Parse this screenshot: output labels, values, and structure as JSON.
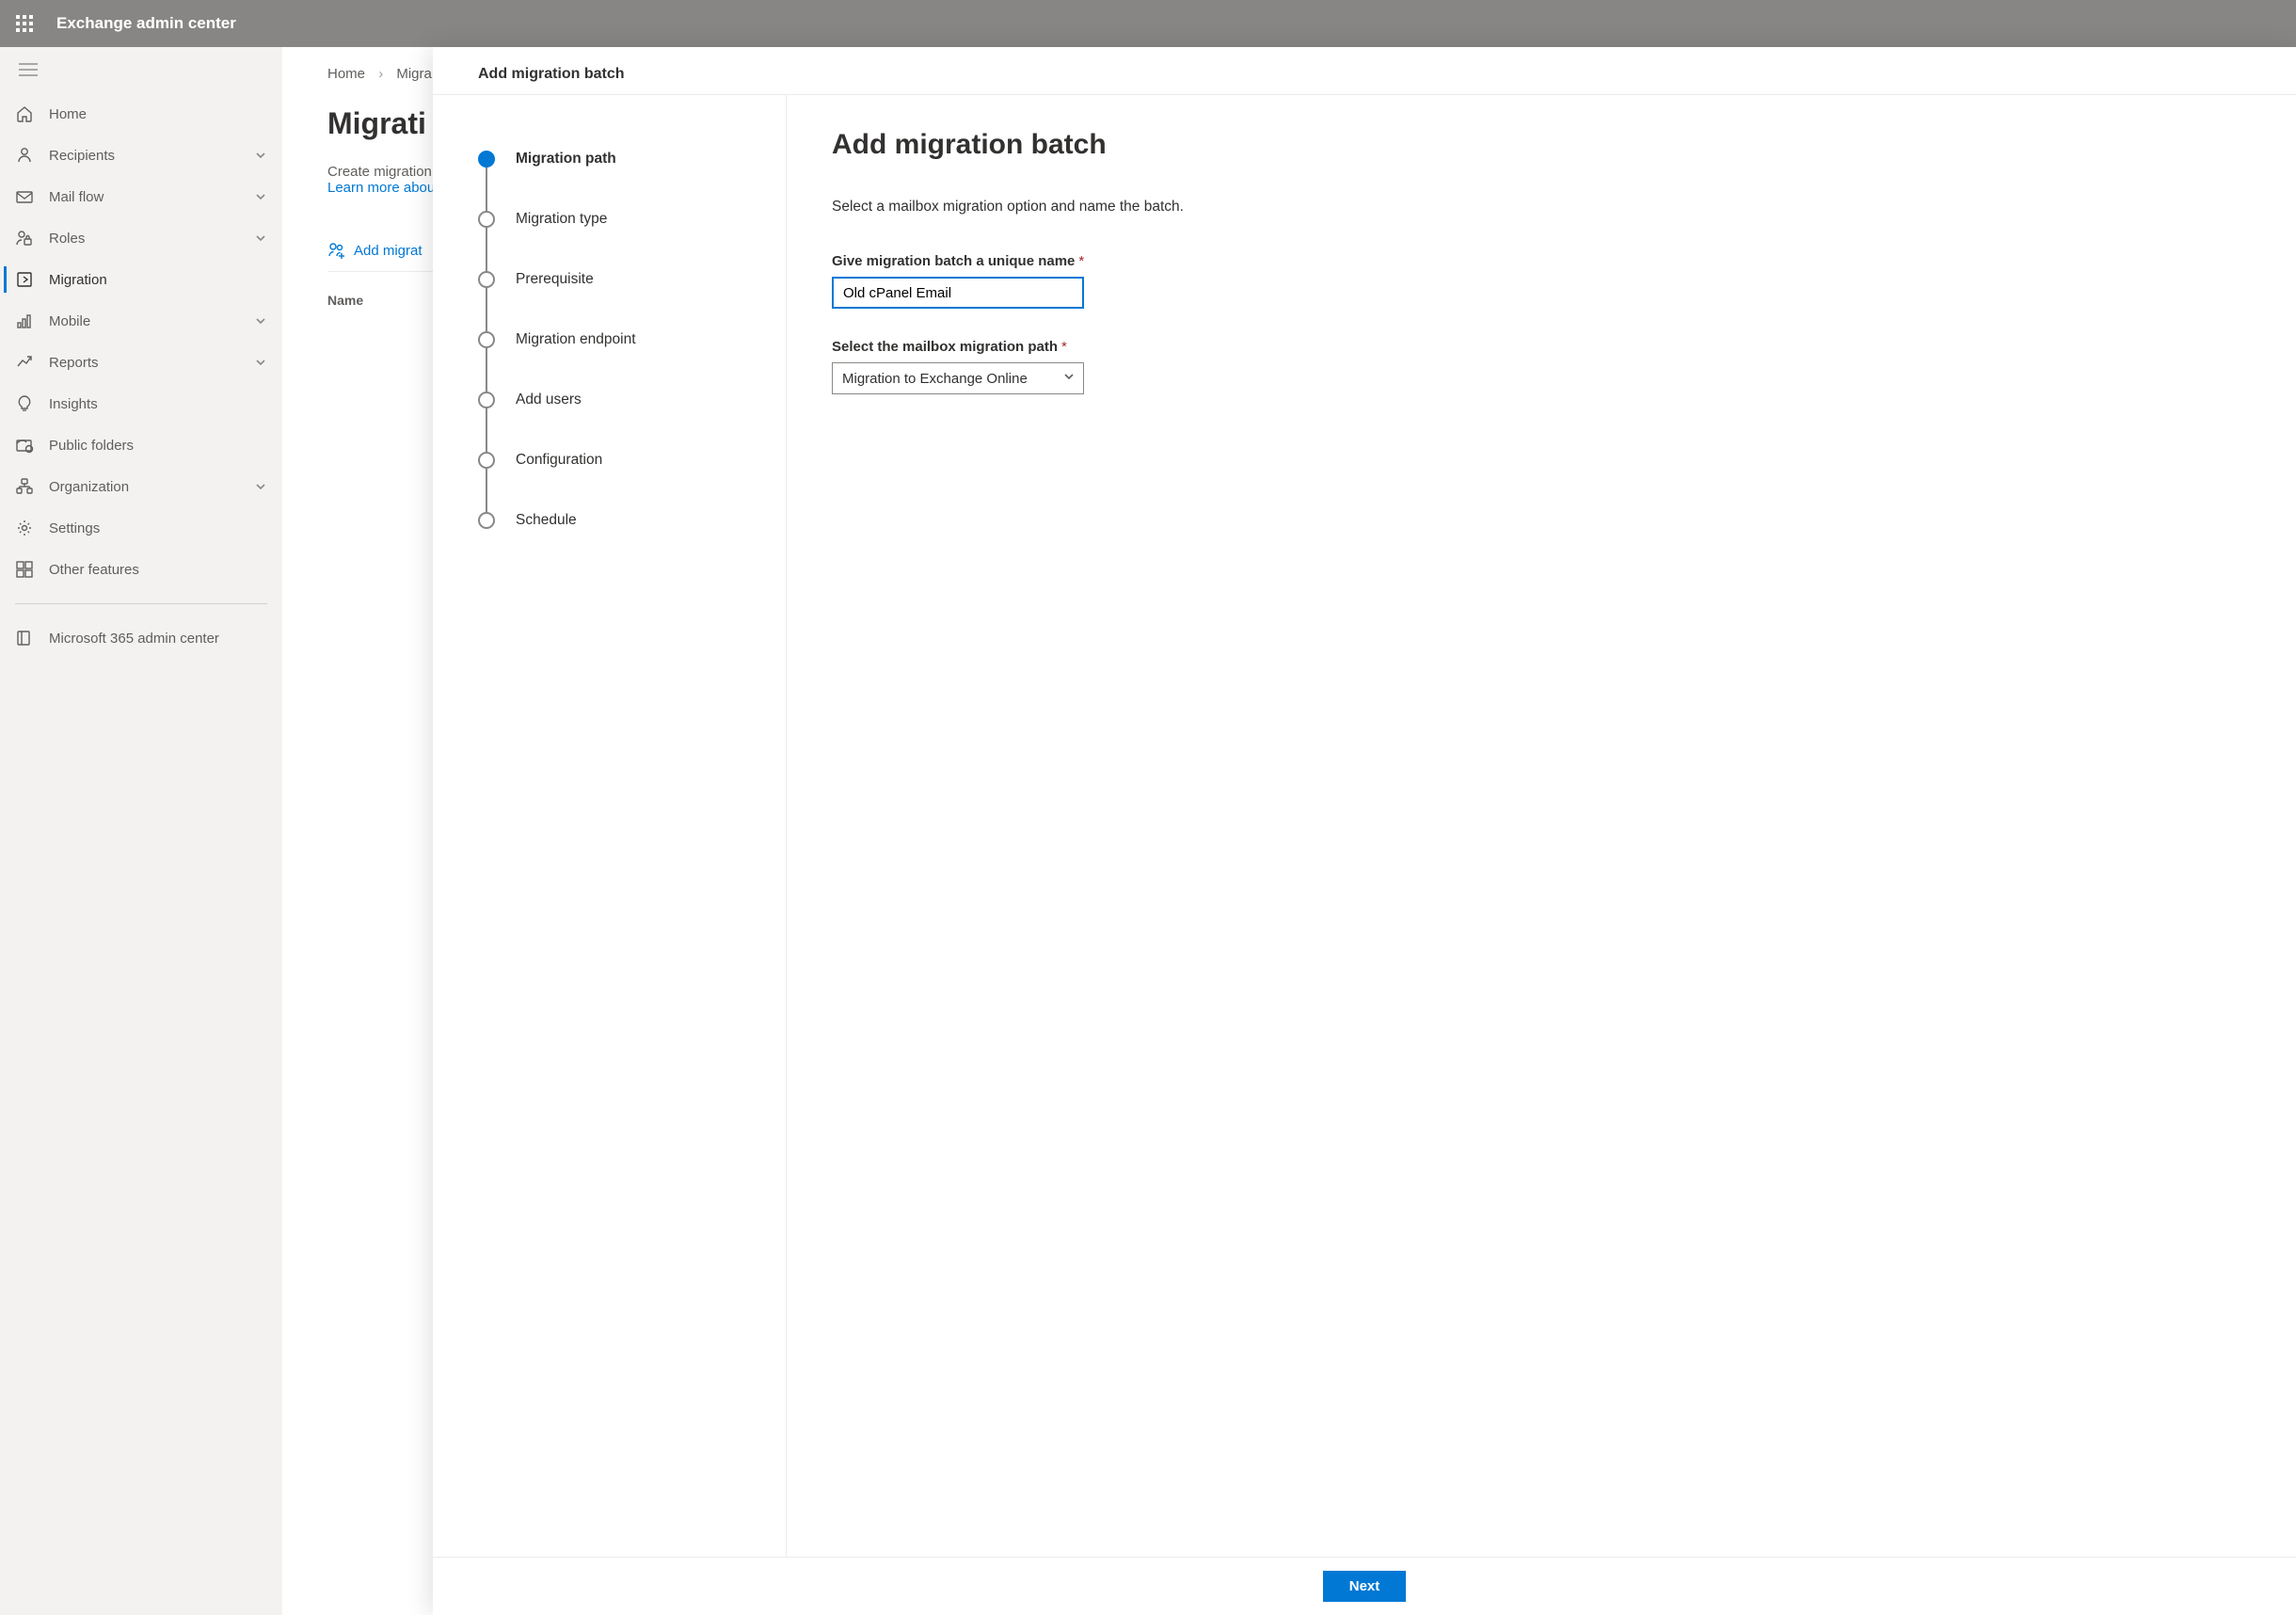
{
  "header": {
    "app_title": "Exchange admin center"
  },
  "sidebar": {
    "items": [
      {
        "label": "Home",
        "icon": "home-icon",
        "expandable": false
      },
      {
        "label": "Recipients",
        "icon": "person-icon",
        "expandable": true
      },
      {
        "label": "Mail flow",
        "icon": "mail-icon",
        "expandable": true
      },
      {
        "label": "Roles",
        "icon": "roles-icon",
        "expandable": true
      },
      {
        "label": "Migration",
        "icon": "migration-icon",
        "expandable": false,
        "active": true
      },
      {
        "label": "Mobile",
        "icon": "mobile-icon",
        "expandable": true
      },
      {
        "label": "Reports",
        "icon": "reports-icon",
        "expandable": true
      },
      {
        "label": "Insights",
        "icon": "insights-icon",
        "expandable": false
      },
      {
        "label": "Public folders",
        "icon": "public-folders-icon",
        "expandable": false
      },
      {
        "label": "Organization",
        "icon": "organization-icon",
        "expandable": true
      },
      {
        "label": "Settings",
        "icon": "settings-icon",
        "expandable": false
      },
      {
        "label": "Other features",
        "icon": "grid-icon",
        "expandable": false
      }
    ],
    "footer_link": "Microsoft 365 admin center"
  },
  "main": {
    "breadcrumb": {
      "home": "Home",
      "current": "Migra"
    },
    "page_title": "Migrati",
    "intro_text": "Create migration",
    "intro_link": "Learn more abou",
    "add_batch_label": "Add migrat",
    "table_col_name": "Name"
  },
  "flyout": {
    "header": "Add migration batch",
    "steps": [
      "Migration path",
      "Migration type",
      "Prerequisite",
      "Migration endpoint",
      "Add users",
      "Configuration",
      "Schedule"
    ],
    "active_step_index": 0,
    "form": {
      "heading": "Add migration batch",
      "intro": "Select a mailbox migration option and name the batch.",
      "name_label": "Give migration batch a unique name",
      "name_value": "Old cPanel Email",
      "path_label": "Select the mailbox migration path",
      "path_value": "Migration to Exchange Online"
    },
    "next_button": "Next"
  }
}
